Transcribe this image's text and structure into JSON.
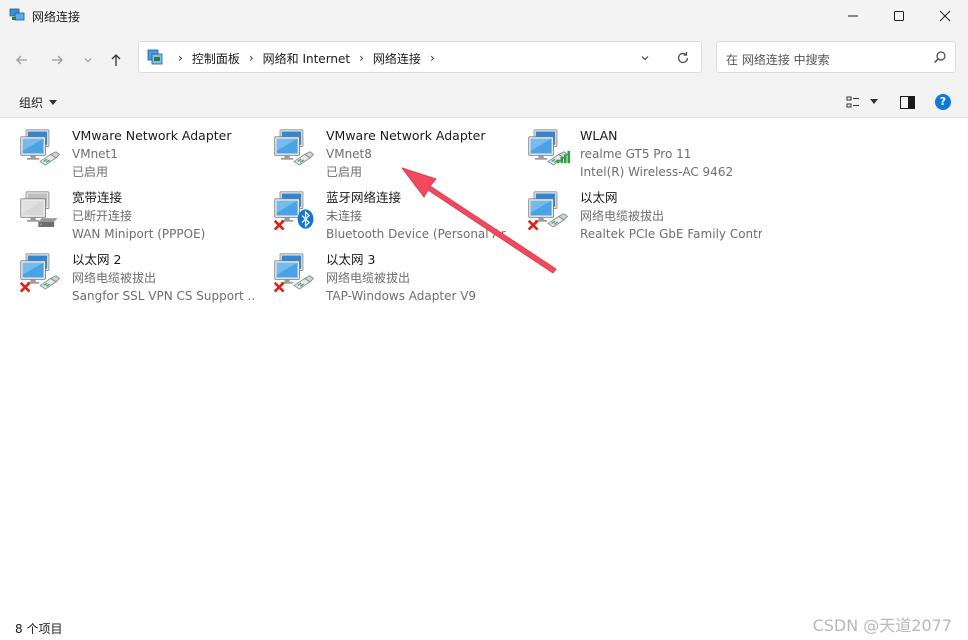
{
  "window": {
    "title": "网络连接",
    "minimize_icon": "minimize-icon",
    "maximize_icon": "maximize-icon",
    "close_icon": "close-icon"
  },
  "nav": {
    "back_icon": "arrow-left-icon",
    "forward_icon": "arrow-right-icon",
    "recent_icon": "chevron-down-icon",
    "up_icon": "arrow-up-icon"
  },
  "address": {
    "crumbs": [
      "控制面板",
      "网络和 Internet",
      "网络连接"
    ],
    "refresh_icon": "refresh-icon"
  },
  "search": {
    "placeholder": "在 网络连接 中搜索"
  },
  "command": {
    "organize": "组织",
    "view_icon": "view-options-icon",
    "preview_icon": "preview-pane-icon",
    "help_icon": "help-icon",
    "help_glyph": "?"
  },
  "items": [
    {
      "name": "VMware Network Adapter",
      "status": "VMnet1",
      "device": "已启用",
      "icon": "network-adapter-icon",
      "state": "enabled"
    },
    {
      "name": "VMware Network Adapter",
      "status": "VMnet8",
      "device": "已启用",
      "icon": "network-adapter-icon",
      "state": "enabled"
    },
    {
      "name": "WLAN",
      "status": "realme GT5 Pro 11",
      "device": "Intel(R) Wireless-AC 9462",
      "icon": "wifi-adapter-icon",
      "state": "connected"
    },
    {
      "name": "宽带连接",
      "status": "已断开连接",
      "device": "WAN Miniport (PPPOE)",
      "icon": "broadband-icon",
      "state": "disconnected"
    },
    {
      "name": "蓝牙网络连接",
      "status": "未连接",
      "device": "Bluetooth Device (Personal Ar",
      "icon": "bluetooth-adapter-icon",
      "state": "error"
    },
    {
      "name": "以太网",
      "status": "网络电缆被拔出",
      "device": "Realtek PCIe GbE Family Contr...",
      "icon": "ethernet-adapter-icon",
      "state": "error"
    },
    {
      "name": "以太网 2",
      "status": "网络电缆被拔出",
      "device": "Sangfor SSL VPN CS Support ...",
      "icon": "ethernet-adapter-icon",
      "state": "error"
    },
    {
      "name": "以太网 3",
      "status": "网络电缆被拔出",
      "device": "TAP-Windows Adapter V9",
      "icon": "ethernet-adapter-icon",
      "state": "error"
    }
  ],
  "status_bar": {
    "count": "8 个项目",
    "watermark": "CSDN @天道2077"
  },
  "colors": {
    "annotation_arrow": "#f04a5e",
    "accent": "#0067c0"
  }
}
